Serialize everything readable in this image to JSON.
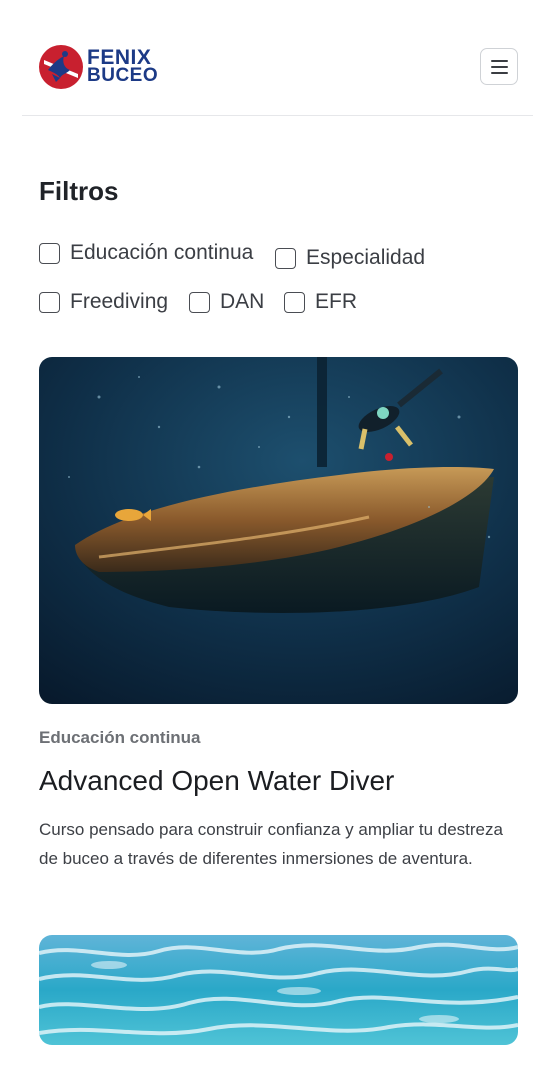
{
  "brand": {
    "line1": "FENIX",
    "line2": "BUCEO",
    "primary_color": "#1c3a86",
    "accent_color": "#c8202f"
  },
  "header": {
    "menu_icon": "hamburger-icon"
  },
  "filters": {
    "title": "Filtros",
    "options": [
      {
        "label": "Educación continua",
        "checked": false
      },
      {
        "label": "Especialidad",
        "checked": false
      },
      {
        "label": "Freediving",
        "checked": false
      },
      {
        "label": "DAN",
        "checked": false
      },
      {
        "label": "EFR",
        "checked": false
      }
    ]
  },
  "courses": [
    {
      "category": "Educación continua",
      "title": "Advanced Open Water Diver",
      "description": "Curso pensado para construir confianza y ampliar tu destreza de buceo a través de diferentes inmersiones de aventura.",
      "image": "shipwreck-diver-photo"
    },
    {
      "image": "ocean-surface-photo"
    }
  ]
}
